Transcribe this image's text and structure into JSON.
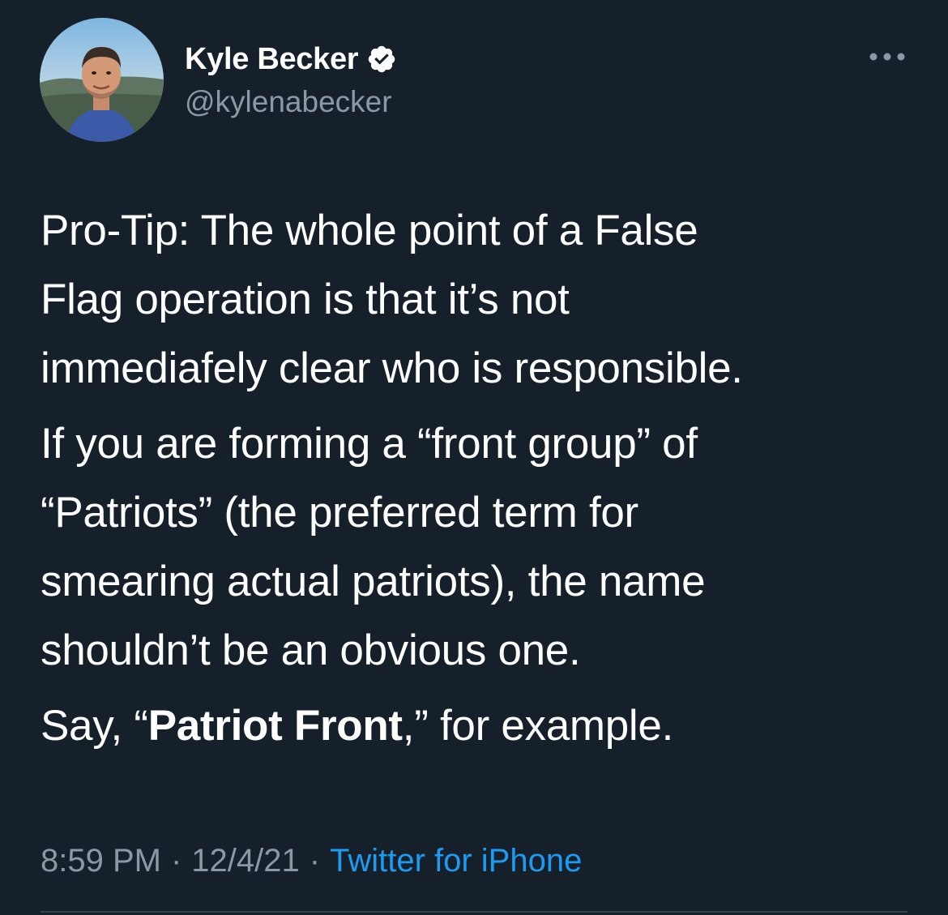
{
  "author": {
    "display_name": "Kyle Becker",
    "handle": "@kylenabecker",
    "verified_icon": "verified-badge-icon"
  },
  "actions": {
    "more_icon": "more-horizontal-icon"
  },
  "tweet": {
    "paragraph_1": "Pro-Tip: The whole point of a False\nFlag operation is that it’s not\nimmediafely clear who is responsible.",
    "paragraph_2": "If you are forming a “front group” of\n“Patriots” (the preferred term for\nsmearing actual patriots), the name\nshouldn’t be an obvious one.",
    "paragraph_3_prefix": "Say, “",
    "paragraph_3_bold": "Patriot Front",
    "paragraph_3_suffix": ",” for example."
  },
  "meta": {
    "time": "8:59 PM",
    "separator": "·",
    "date": "12/4/21",
    "source": "Twitter for iPhone"
  },
  "colors": {
    "background": "#15202b",
    "text_primary": "#ffffff",
    "text_secondary": "#8b98a5",
    "link": "#1d9bf0"
  }
}
